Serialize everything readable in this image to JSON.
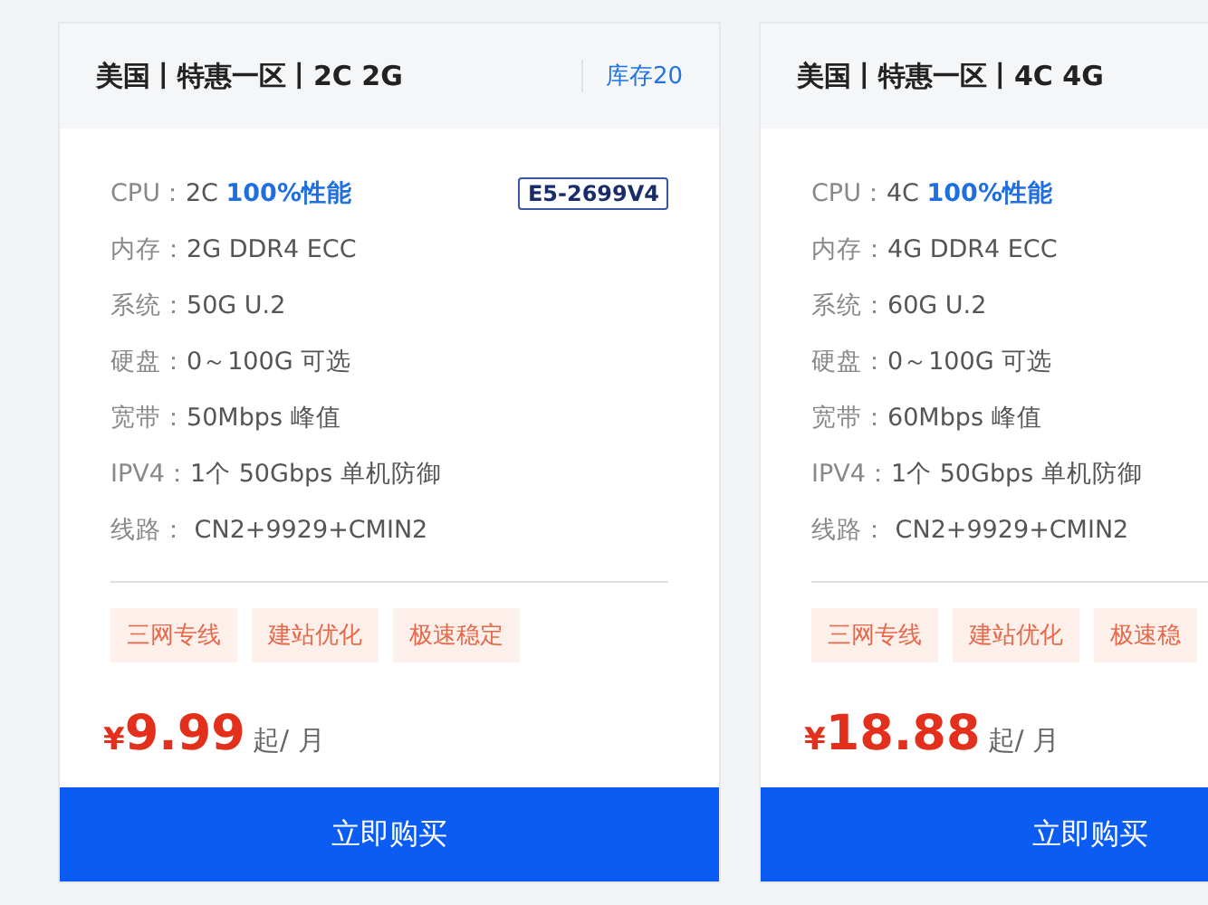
{
  "plans": [
    {
      "title": "美国丨特惠一区丨2C 2G",
      "stock": "库存20",
      "cpu_badge": "E5-2699V4",
      "specs": [
        {
          "label": "CPU：",
          "value": "2C",
          "highlight": "100%性能"
        },
        {
          "label": "内存：",
          "value": "2G DDR4 ECC"
        },
        {
          "label": "系统：",
          "value": "50G U.2"
        },
        {
          "label": "硬盘：",
          "value": "0～100G 可选"
        },
        {
          "label": "宽带：",
          "value": "50Mbps 峰值"
        },
        {
          "label": "IPV4：",
          "value": "1个 50Gbps 单机防御"
        },
        {
          "label": "线路：",
          "value": " CN2+9929+CMIN2"
        }
      ],
      "tags": [
        "三网专线",
        "建站优化",
        "极速稳定"
      ],
      "currency": "¥",
      "price": "9.99",
      "unit": "起/ 月",
      "button": "立即购买"
    },
    {
      "title": "美国丨特惠一区丨4C 4G",
      "specs": [
        {
          "label": "CPU：",
          "value": "4C",
          "highlight": "100%性能"
        },
        {
          "label": "内存：",
          "value": "4G DDR4 ECC"
        },
        {
          "label": "系统：",
          "value": "60G U.2"
        },
        {
          "label": "硬盘：",
          "value": "0～100G 可选"
        },
        {
          "label": "宽带：",
          "value": "60Mbps 峰值"
        },
        {
          "label": "IPV4：",
          "value": "1个 50Gbps 单机防御"
        },
        {
          "label": "线路：",
          "value": " CN2+9929+CMIN2"
        }
      ],
      "tags": [
        "三网专线",
        "建站优化",
        "极速稳"
      ],
      "currency": "¥",
      "price": "18.88",
      "unit": "起/ 月",
      "button": "立即购买"
    }
  ]
}
